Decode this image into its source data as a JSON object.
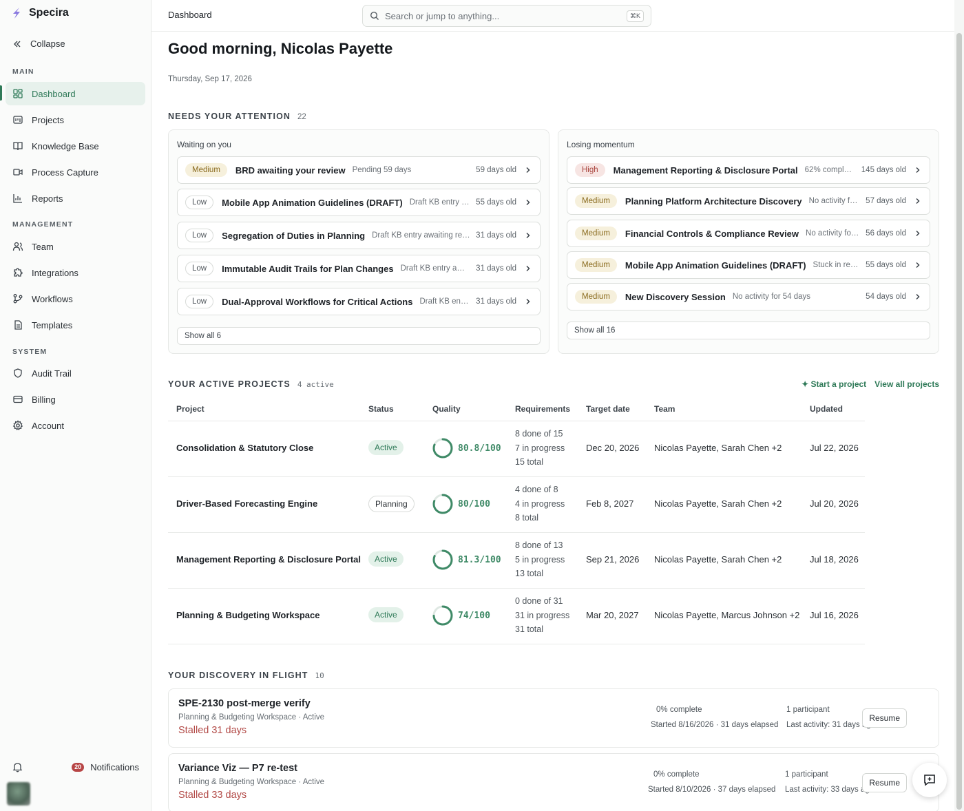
{
  "app": {
    "name": "Specira"
  },
  "sidebar": {
    "collapse_label": "Collapse",
    "sections": {
      "main": "MAIN",
      "management": "MANAGEMENT",
      "system": "SYSTEM"
    },
    "main_items": [
      {
        "label": "Dashboard",
        "icon": "grid-icon",
        "active": true
      },
      {
        "label": "Projects",
        "icon": "folder-icon"
      },
      {
        "label": "Knowledge Base",
        "icon": "book-icon"
      },
      {
        "label": "Process Capture",
        "icon": "video-icon"
      },
      {
        "label": "Reports",
        "icon": "bar-chart-icon"
      }
    ],
    "management_items": [
      {
        "label": "Team",
        "icon": "users-icon"
      },
      {
        "label": "Integrations",
        "icon": "puzzle-icon"
      },
      {
        "label": "Workflows",
        "icon": "git-branch-icon"
      },
      {
        "label": "Templates",
        "icon": "file-icon"
      }
    ],
    "system_items": [
      {
        "label": "Audit Trail",
        "icon": "shield-icon"
      },
      {
        "label": "Billing",
        "icon": "credit-card-icon"
      },
      {
        "label": "Account",
        "icon": "gear-icon"
      }
    ],
    "notifications": {
      "count": "20",
      "label": "Notifications"
    }
  },
  "topbar": {
    "title": "Dashboard",
    "search_placeholder": "Search or jump to anything...",
    "shortcut": "⌘K"
  },
  "main": {
    "greeting": "Good morning, Nicolas Payette",
    "date": "Thursday, Sep 17, 2026",
    "attention": {
      "heading": "NEEDS YOUR ATTENTION",
      "count": "22",
      "waiting": {
        "title": "Waiting on you",
        "show_all": "Show all 6",
        "items": [
          {
            "priority": "Medium",
            "title": "BRD awaiting your review",
            "desc": "Pending 59 days",
            "age": "59 days old"
          },
          {
            "priority": "Low",
            "title": "Mobile App Animation Guidelines (DRAFT)",
            "desc": "Draft KB entry a...",
            "age": "55 days old"
          },
          {
            "priority": "Low",
            "title": "Segregation of Duties in Planning",
            "desc": "Draft KB entry awaiting revi...",
            "age": "31 days old"
          },
          {
            "priority": "Low",
            "title": "Immutable Audit Trails for Plan Changes",
            "desc": "Draft KB entry await...",
            "age": "31 days old"
          },
          {
            "priority": "Low",
            "title": "Dual-Approval Workflows for Critical Actions",
            "desc": "Draft KB entry...",
            "age": "31 days old"
          }
        ]
      },
      "losing": {
        "title": "Losing momentum",
        "show_all": "Show all 16",
        "items": [
          {
            "priority": "High",
            "title": "Management Reporting & Disclosure Portal",
            "desc": "62% complete...",
            "age": "145 days old"
          },
          {
            "priority": "Medium",
            "title": "Planning Platform Architecture Discovery",
            "desc": "No activity fo...",
            "age": "57 days old"
          },
          {
            "priority": "Medium",
            "title": "Financial Controls & Compliance Review",
            "desc": "No activity for ...",
            "age": "56 days old"
          },
          {
            "priority": "Medium",
            "title": "Mobile App Animation Guidelines (DRAFT)",
            "desc": "Stuck in revi...",
            "age": "55 days old"
          },
          {
            "priority": "Medium",
            "title": "New Discovery Session",
            "desc": "No activity for 54 days",
            "age": "54 days old"
          }
        ]
      }
    },
    "projects": {
      "heading": "YOUR ACTIVE PROJECTS",
      "count": "4 active",
      "start_label": "✦ Start a project",
      "view_all_label": "View all projects",
      "columns": [
        "Project",
        "Status",
        "Quality",
        "Requirements",
        "Target date",
        "Team",
        "Updated"
      ],
      "rows": [
        {
          "name": "Consolidation & Statutory Close",
          "status": "Active",
          "quality": "80.8/100",
          "quality_pct": 80.8,
          "req": [
            "8 done of 15",
            "7 in progress",
            "15 total"
          ],
          "target": "Dec 20, 2026",
          "team": "Nicolas Payette, Sarah Chen +2",
          "updated": "Jul 22, 2026"
        },
        {
          "name": "Driver-Based Forecasting Engine",
          "status": "Planning",
          "quality": "80/100",
          "quality_pct": 80,
          "req": [
            "4 done of 8",
            "4 in progress",
            "8 total"
          ],
          "target": "Feb 8, 2027",
          "team": "Nicolas Payette, Sarah Chen +2",
          "updated": "Jul 20, 2026"
        },
        {
          "name": "Management Reporting & Disclosure Portal",
          "status": "Active",
          "quality": "81.3/100",
          "quality_pct": 81.3,
          "req": [
            "8 done of 13",
            "5 in progress",
            "13 total"
          ],
          "target": "Sep 21, 2026",
          "team": "Nicolas Payette, Sarah Chen +2",
          "updated": "Jul 18, 2026"
        },
        {
          "name": "Planning & Budgeting Workspace",
          "status": "Active",
          "quality": "74/100",
          "quality_pct": 74,
          "req": [
            "0 done of 31",
            "31 in progress",
            "31 total"
          ],
          "target": "Mar 20, 2027",
          "team": "Nicolas Payette, Marcus Johnson +2",
          "updated": "Jul 16, 2026"
        }
      ]
    },
    "discovery": {
      "heading": "YOUR DISCOVERY IN FLIGHT",
      "count": "10",
      "items": [
        {
          "title": "SPE-2130 post-merge verify",
          "sub": "Planning & Budgeting Workspace · Active",
          "stalled": "Stalled 31 days",
          "pct": "0% complete",
          "started": "Started 8/16/2026 · 31 days elapsed",
          "participants": "1 participant",
          "last": "Last activity: 31 days ago",
          "action": "Resume"
        },
        {
          "title": "Variance Viz — P7 re-test",
          "sub": "Planning & Budgeting Workspace · Active",
          "stalled": "Stalled 33 days",
          "pct": "0% complete",
          "started": "Started 8/10/2026 · 37 days elapsed",
          "participants": "1 participant",
          "last": "Last activity: 33 days ago",
          "action": "Resume"
        }
      ]
    }
  }
}
